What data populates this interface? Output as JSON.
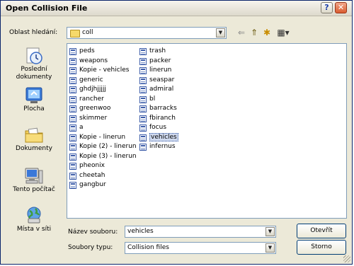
{
  "title": "Open Collision File",
  "titlebar": {
    "help": "?",
    "close": "✕"
  },
  "lookin": {
    "label": "Oblast hledání:",
    "value": "coll"
  },
  "toolbar": {
    "back": "⇐",
    "up": "⇑",
    "new_folder": "✱",
    "views": "▦▾"
  },
  "places": [
    {
      "label": "Poslední dokumenty"
    },
    {
      "label": "Plocha"
    },
    {
      "label": "Dokumenty"
    },
    {
      "label": "Tento počítač"
    },
    {
      "label": "Místa v síti"
    }
  ],
  "files": {
    "col1": [
      "peds",
      "weapons",
      "Kopie - vehicles",
      "generic",
      "ghdjhjjjjj",
      "rancher",
      "greenwoo",
      "skimmer",
      "a",
      "Kopie - linerun",
      "Kopie (2) - linerun",
      "Kopie (3) - linerun",
      "pheonix",
      "cheetah",
      "gangbur"
    ],
    "col2": [
      "trash",
      "packer",
      "linerun",
      "seaspar",
      "admiral",
      "bl",
      "barracks",
      "fbiranch",
      "focus",
      "vehicles",
      "infernus"
    ],
    "selected": "vehicles"
  },
  "filename": {
    "label": "Název souboru:",
    "value": "vehicles"
  },
  "filetype": {
    "label": "Soubory typu:",
    "value": "Collision files"
  },
  "buttons": {
    "open": "Otevřít",
    "cancel": "Storno"
  }
}
